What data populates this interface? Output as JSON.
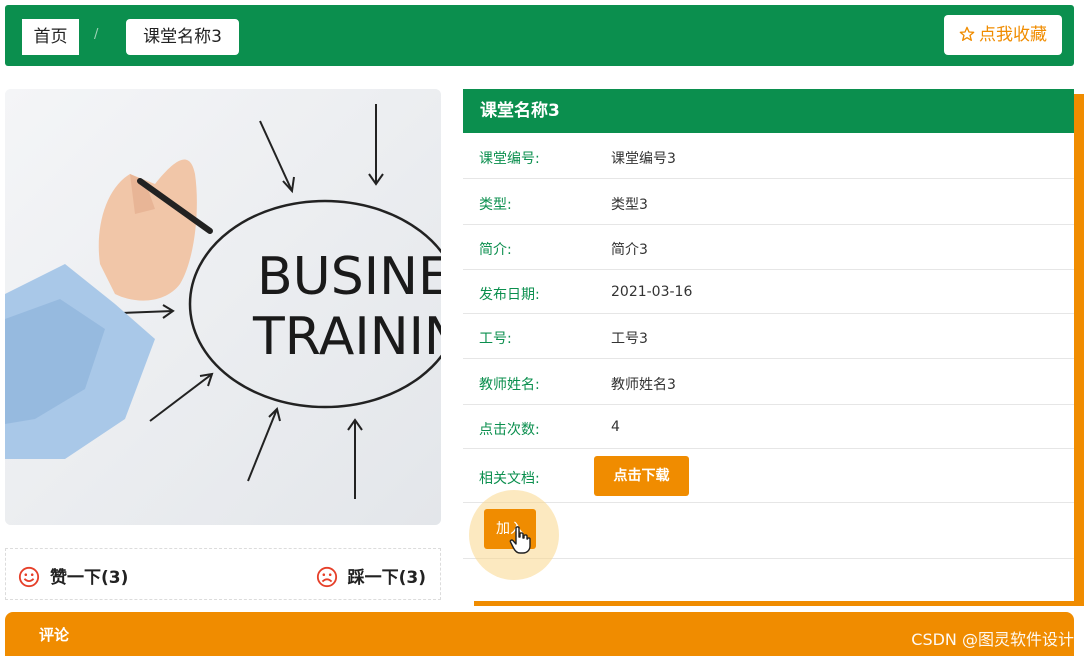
{
  "breadcrumb": {
    "home": "首页",
    "separator": "/",
    "current": "课堂名称3"
  },
  "favorite": {
    "label": "点我收藏",
    "icon": "star-outline-icon"
  },
  "hero": {
    "text_line1": "BUSINES",
    "text_line2": "TRAININ"
  },
  "votes": {
    "like_label": "赞一下(3)",
    "like_icon": "smile-face-icon",
    "dislike_label": "踩一下(3)",
    "dislike_icon": "sad-face-icon"
  },
  "detail": {
    "title": "课堂名称3",
    "rows": [
      {
        "key": "课堂编号:",
        "value": "课堂编号3"
      },
      {
        "key": "类型:",
        "value": "类型3"
      },
      {
        "key": "简介:",
        "value": "简介3"
      },
      {
        "key": "发布日期:",
        "value": "2021-03-16"
      },
      {
        "key": "工号:",
        "value": "工号3"
      },
      {
        "key": "教师姓名:",
        "value": "教师姓名3"
      },
      {
        "key": "点击次数:",
        "value": "4"
      },
      {
        "key": "相关文档:",
        "value": ""
      }
    ],
    "download_label": "点击下载",
    "join_label": "加入"
  },
  "comments": {
    "label": "评论"
  },
  "watermark": "CSDN @图灵软件设计",
  "colors": {
    "primary": "#0b8f4e",
    "accent": "#f08c00"
  }
}
